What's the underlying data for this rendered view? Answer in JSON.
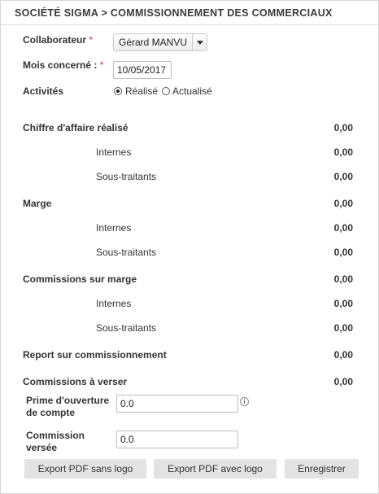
{
  "header": {
    "title": "SOCIÉTÉ SIGMA > COMMISSIONNEMENT DES COMMERCIAUX"
  },
  "form": {
    "collaborateur": {
      "label": "Collaborateur",
      "required_mark": "*",
      "value": "Gérard MANVU"
    },
    "mois": {
      "label": "Mois concerné :",
      "required_mark": "*",
      "value": "10/05/2017"
    },
    "activites": {
      "label": "Activités",
      "options": [
        {
          "label": "Réalisé",
          "selected": true
        },
        {
          "label": "Actualisé",
          "selected": false
        }
      ]
    }
  },
  "summary": {
    "chiffre": {
      "label": "Chiffre d'affaire réalisé",
      "value": "0,00",
      "internes": {
        "label": "Internes",
        "value": "0,00"
      },
      "sous_traitants": {
        "label": "Sous-traitants",
        "value": "0,00"
      }
    },
    "marge": {
      "label": "Marge",
      "value": "0,00",
      "internes": {
        "label": "Internes",
        "value": "0,00"
      },
      "sous_traitants": {
        "label": "Sous-traitants",
        "value": "0,00"
      }
    },
    "commissions_marge": {
      "label": "Commissions sur marge",
      "value": "0,00",
      "internes": {
        "label": "Internes",
        "value": "0,00"
      },
      "sous_traitants": {
        "label": "Sous-traitants",
        "value": "0,00"
      }
    },
    "report": {
      "label": "Report sur commissionnement",
      "value": "0,00"
    },
    "a_verser": {
      "label": "Commissions à verser",
      "value": "0,00"
    }
  },
  "fields": {
    "prime": {
      "label_line1": "Prime d'ouverture",
      "label_line2": "de compte",
      "value": "0.0",
      "info_icon": "info-icon"
    },
    "commission_versee": {
      "label_line1": "Commission",
      "label_line2": "versée",
      "value": "0.0"
    }
  },
  "buttons": {
    "export_sans_logo": "Export PDF sans logo",
    "export_avec_logo": "Export PDF avec logo",
    "enregistrer": "Enregistrer"
  }
}
